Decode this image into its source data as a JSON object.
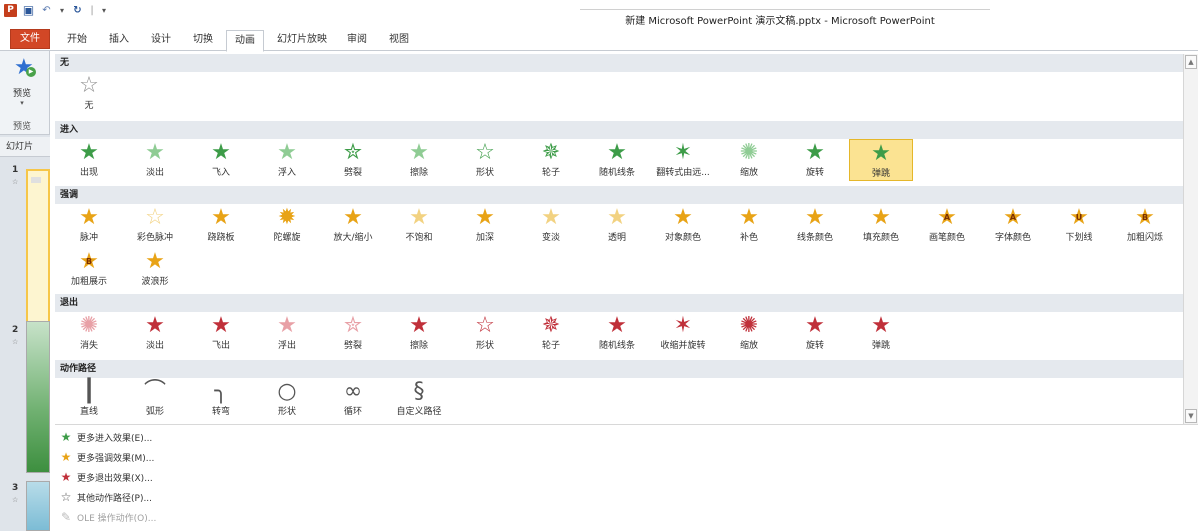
{
  "app": {
    "window_title": "新建 Microsoft PowerPoint 演示文稿.pptx - Microsoft PowerPoint"
  },
  "ribbon": {
    "tabs": [
      "文件",
      "开始",
      "插入",
      "设计",
      "切换",
      "动画",
      "幻灯片放映",
      "审阅",
      "视图"
    ],
    "active_tab": "动画",
    "preview_group": {
      "button_label": "预览",
      "group_label": "预览"
    }
  },
  "slides_pane": {
    "tab_label": "幻灯片",
    "thumbnails": [
      {
        "number": "1"
      },
      {
        "number": "2"
      },
      {
        "number": "3"
      }
    ]
  },
  "gallery": {
    "sections": [
      {
        "title": "无",
        "items": [
          {
            "label": "无",
            "icon": "star-outline-icon",
            "color": "gray"
          }
        ]
      },
      {
        "title": "进入",
        "items": [
          {
            "label": "出现",
            "icon": "star-icon",
            "color": "green"
          },
          {
            "label": "淡出",
            "icon": "star-icon",
            "color": "green-light"
          },
          {
            "label": "飞入",
            "icon": "star-fly-icon",
            "color": "green"
          },
          {
            "label": "浮入",
            "icon": "star-icon",
            "color": "green-light"
          },
          {
            "label": "劈裂",
            "icon": "star-split-icon",
            "color": "green"
          },
          {
            "label": "擦除",
            "icon": "star-icon",
            "color": "green-light"
          },
          {
            "label": "形状",
            "icon": "star-outline-icon",
            "color": "green"
          },
          {
            "label": "轮子",
            "icon": "star-wheel-icon",
            "color": "green"
          },
          {
            "label": "随机线条",
            "icon": "star-lines-icon",
            "color": "green"
          },
          {
            "label": "翻转式由远...",
            "icon": "star-flip-icon",
            "color": "green"
          },
          {
            "label": "缩放",
            "icon": "star-zoom-icon",
            "color": "green-light"
          },
          {
            "label": "旋转",
            "icon": "star-swivel-icon",
            "color": "green"
          },
          {
            "label": "弹跳",
            "icon": "star-bounce-icon",
            "color": "green",
            "selected": true
          }
        ]
      },
      {
        "title": "强调",
        "items": [
          {
            "label": "脉冲",
            "icon": "star-icon",
            "color": "gold"
          },
          {
            "label": "彩色脉冲",
            "icon": "star-outline-icon",
            "color": "gold-pale"
          },
          {
            "label": "跷跷板",
            "icon": "star-icon",
            "color": "gold"
          },
          {
            "label": "陀螺旋",
            "icon": "star-spin-icon",
            "color": "gold"
          },
          {
            "label": "放大/缩小",
            "icon": "star-grow-icon",
            "color": "gold"
          },
          {
            "label": "不饱和",
            "icon": "star-icon",
            "color": "gold-pale"
          },
          {
            "label": "加深",
            "icon": "star-dark-icon",
            "color": "gold"
          },
          {
            "label": "变淡",
            "icon": "star-icon",
            "color": "gold-pale"
          },
          {
            "label": "透明",
            "icon": "star-icon",
            "color": "gold-pale"
          },
          {
            "label": "对象颜色",
            "icon": "star-color-icon",
            "color": "gold"
          },
          {
            "label": "补色",
            "icon": "star-complement-icon",
            "color": "gold"
          },
          {
            "label": "线条颜色",
            "icon": "star-icon",
            "color": "gold"
          },
          {
            "label": "填充颜色",
            "icon": "star-fill-icon",
            "color": "gold"
          },
          {
            "label": "画笔颜色",
            "icon": "star-letter-a-icon",
            "color": "gold"
          },
          {
            "label": "字体颜色",
            "icon": "star-letter-a-icon",
            "color": "gold"
          },
          {
            "label": "下划线",
            "icon": "star-underline-icon",
            "color": "gold"
          },
          {
            "label": "加粗闪烁",
            "icon": "star-bold-b-icon",
            "color": "gold"
          },
          {
            "label": "加粗展示",
            "icon": "star-bold-b-icon",
            "color": "gold"
          },
          {
            "label": "波浪形",
            "icon": "star-icon",
            "color": "gold"
          }
        ]
      },
      {
        "title": "退出",
        "items": [
          {
            "label": "消失",
            "icon": "star-burst-icon",
            "color": "red-light"
          },
          {
            "label": "淡出",
            "icon": "star-icon",
            "color": "red"
          },
          {
            "label": "飞出",
            "icon": "star-fly-icon",
            "color": "red"
          },
          {
            "label": "浮出",
            "icon": "star-icon",
            "color": "red-light"
          },
          {
            "label": "劈裂",
            "icon": "star-split-icon",
            "color": "red-light"
          },
          {
            "label": "擦除",
            "icon": "star-icon",
            "color": "red"
          },
          {
            "label": "形状",
            "icon": "star-outline-icon",
            "color": "red"
          },
          {
            "label": "轮子",
            "icon": "star-wheel-icon",
            "color": "red"
          },
          {
            "label": "随机线条",
            "icon": "star-lines-icon",
            "color": "red"
          },
          {
            "label": "收缩并旋转",
            "icon": "star-flip-icon",
            "color": "red"
          },
          {
            "label": "缩放",
            "icon": "star-zoom-icon",
            "color": "red"
          },
          {
            "label": "旋转",
            "icon": "star-swivel-icon",
            "color": "red"
          },
          {
            "label": "弹跳",
            "icon": "star-bounce-icon",
            "color": "red"
          }
        ]
      },
      {
        "title": "动作路径",
        "items": [
          {
            "label": "直线",
            "icon": "path-line-icon",
            "color": "path"
          },
          {
            "label": "弧形",
            "icon": "path-arc-icon",
            "color": "path"
          },
          {
            "label": "转弯",
            "icon": "path-turn-icon",
            "color": "path"
          },
          {
            "label": "形状",
            "icon": "path-circle-icon",
            "color": "path"
          },
          {
            "label": "循环",
            "icon": "path-loop-icon",
            "color": "path"
          },
          {
            "label": "自定义路径",
            "icon": "path-custom-icon",
            "color": "path"
          }
        ]
      }
    ]
  },
  "more_menu": [
    {
      "label": "更多进入效果(E)...",
      "icon": "more-entrance-icon",
      "color": "#3d9c48"
    },
    {
      "label": "更多强调效果(M)...",
      "icon": "more-emphasis-icon",
      "color": "#e8a316"
    },
    {
      "label": "更多退出效果(X)...",
      "icon": "more-exit-icon",
      "color": "#c0303a"
    },
    {
      "label": "其他动作路径(P)...",
      "icon": "more-paths-icon",
      "color": "#555555"
    },
    {
      "label": "OLE 操作动作(O)...",
      "icon": "ole-action-icon",
      "color": "#bbbbbb",
      "disabled": true
    }
  ]
}
